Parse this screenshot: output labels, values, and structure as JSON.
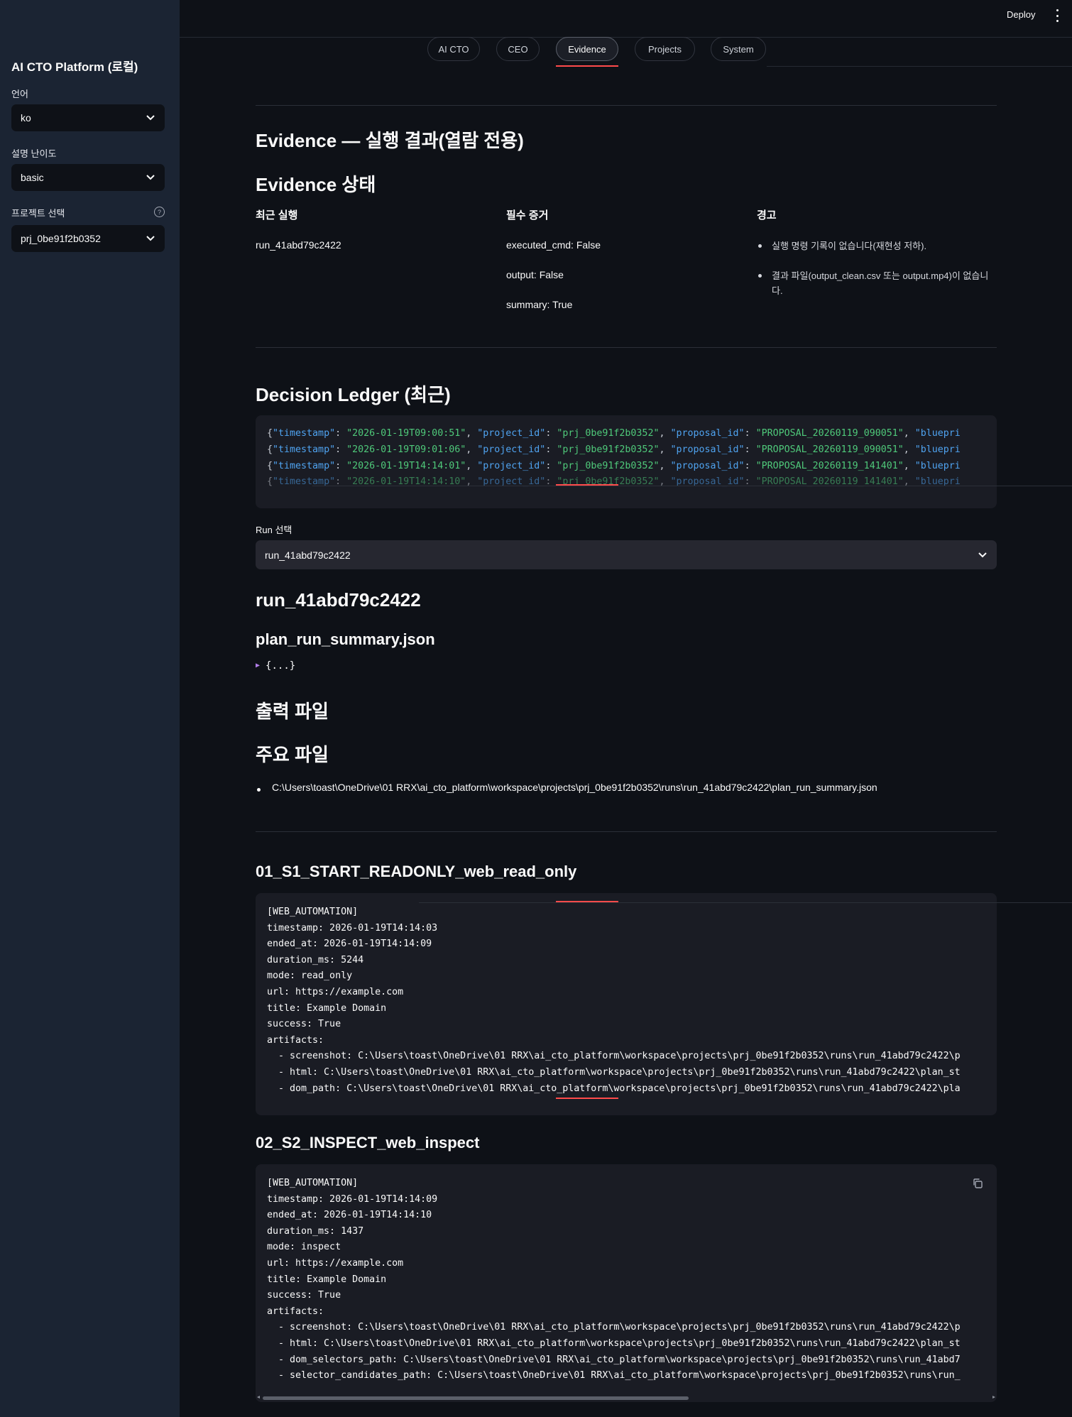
{
  "header": {
    "deploy_label": "Deploy"
  },
  "sidebar": {
    "title": "AI CTO Platform (로컬)",
    "language": {
      "label": "언어",
      "value": "ko"
    },
    "difficulty": {
      "label": "설명 난이도",
      "value": "basic"
    },
    "project": {
      "label": "프로젝트 선택",
      "value": "prj_0be91f2b0352"
    }
  },
  "tabs": [
    "AI CTO",
    "CEO",
    "Evidence",
    "Projects",
    "System"
  ],
  "active_tab": "Evidence",
  "evidence": {
    "page_title": "Evidence — 실행 결과(열람 전용)",
    "status_title": "Evidence 상태",
    "recent_run": {
      "header": "최근 실행",
      "value": "run_41abd79c2422"
    },
    "required": {
      "header": "필수 증거",
      "items": [
        "executed_cmd: False",
        "output: False",
        "summary: True"
      ]
    },
    "warnings": {
      "header": "경고",
      "items": [
        "실행 명령 기록이 없습니다(재현성 저하).",
        "결과 파일(output_clean.csv 또는 output.mp4)이 없습니다."
      ]
    }
  },
  "ledger": {
    "title": "Decision Ledger (최근)",
    "rows": [
      {
        "timestamp": "2026-01-19T09:00:51",
        "project_id": "prj_0be91f2b0352",
        "proposal_id": "PROPOSAL_20260119_090051",
        "tail": "\"bluepri"
      },
      {
        "timestamp": "2026-01-19T09:01:06",
        "project_id": "prj_0be91f2b0352",
        "proposal_id": "PROPOSAL_20260119_090051",
        "tail": "\"bluepri"
      },
      {
        "timestamp": "2026-01-19T14:14:01",
        "project_id": "prj_0be91f2b0352",
        "proposal_id": "PROPOSAL_20260119_141401",
        "tail": "\"bluepri"
      },
      {
        "timestamp": "2026-01-19T14:14:10",
        "project_id": "prj_0be91f2b0352",
        "proposal_id": "PROPOSAL_20260119_141401",
        "tail": "\"bluepri"
      }
    ]
  },
  "run_select": {
    "label": "Run 선택",
    "value": "run_41abd79c2422"
  },
  "run": {
    "title": "run_41abd79c2422",
    "summary_file": "plan_run_summary.json",
    "json_collapsed": "{...}",
    "output_files_title": "출력 파일",
    "key_files_title": "주요 파일",
    "key_file_path": "C:\\Users\\toast\\OneDrive\\01 RRX\\ai_cto_platform\\workspace\\projects\\prj_0be91f2b0352\\runs\\run_41abd79c2422\\plan_run_summary.json"
  },
  "steps": [
    {
      "title": "01_S1_START_READONLY_web_read_only",
      "lines": [
        "[WEB_AUTOMATION]",
        "timestamp: 2026-01-19T14:14:03",
        "ended_at: 2026-01-19T14:14:09",
        "duration_ms: 5244",
        "mode: read_only",
        "url: https://example.com",
        "title: Example Domain",
        "success: True",
        "artifacts:",
        "  - screenshot: C:\\Users\\toast\\OneDrive\\01 RRX\\ai_cto_platform\\workspace\\projects\\prj_0be91f2b0352\\runs\\run_41abd79c2422\\p",
        "  - html: C:\\Users\\toast\\OneDrive\\01 RRX\\ai_cto_platform\\workspace\\projects\\prj_0be91f2b0352\\runs\\run_41abd79c2422\\plan_st",
        "  - dom_path: C:\\Users\\toast\\OneDrive\\01 RRX\\ai_cto_platform\\workspace\\projects\\prj_0be91f2b0352\\runs\\run_41abd79c2422\\pla"
      ]
    },
    {
      "title": "02_S2_INSPECT_web_inspect",
      "lines": [
        "[WEB_AUTOMATION]",
        "timestamp: 2026-01-19T14:14:09",
        "ended_at: 2026-01-19T14:14:10",
        "duration_ms: 1437",
        "mode: inspect",
        "url: https://example.com",
        "title: Example Domain",
        "success: True",
        "artifacts:",
        "  - screenshot: C:\\Users\\toast\\OneDrive\\01 RRX\\ai_cto_platform\\workspace\\projects\\prj_0be91f2b0352\\runs\\run_41abd79c2422\\p",
        "  - html: C:\\Users\\toast\\OneDrive\\01 RRX\\ai_cto_platform\\workspace\\projects\\prj_0be91f2b0352\\runs\\run_41abd79c2422\\plan_st",
        "  - dom_selectors_path: C:\\Users\\toast\\OneDrive\\01 RRX\\ai_cto_platform\\workspace\\projects\\prj_0be91f2b0352\\runs\\run_41abd7",
        "  - selector_candidates_path: C:\\Users\\toast\\OneDrive\\01 RRX\\ai_cto_platform\\workspace\\projects\\prj_0be91f2b0352\\runs\\run_"
      ]
    }
  ],
  "colors": {
    "accent": "#ff4b4b",
    "background": "#0e1117",
    "sidebar": "#1b2433",
    "code_key": "#4fa3f0",
    "code_string": "#4fc97a"
  },
  "icons": {
    "select_chevron": "chevron-down-icon",
    "help": "help-circle-icon",
    "menu": "kebab-menu-icon",
    "copy": "copy-icon",
    "expand": "caret-right-icon"
  }
}
